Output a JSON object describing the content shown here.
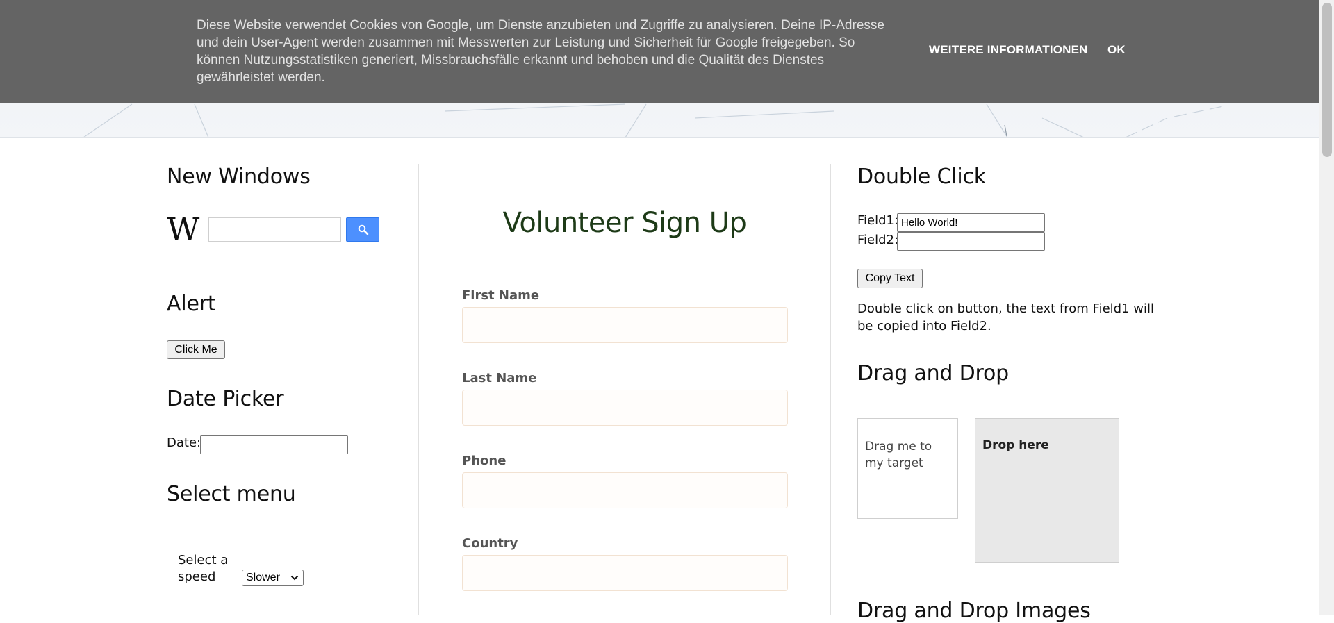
{
  "cookie_banner": {
    "text": "Diese Website verwendet Cookies von Google, um Dienste anzubieten und Zugriffe zu analysieren. Deine IP-Adresse und dein User-Agent werden zusammen mit Messwerten zur Leistung und Sicherheit für Google freigegeben. So können Nutzungsstatistiken generiert, Missbrauchsfälle erkannt und behoben und die Qualität des Dienstes gewährleistet werden.",
    "more_info_label": "WEITERE INFORMATIONEN",
    "ok_label": "OK"
  },
  "left": {
    "new_windows": {
      "heading": "New Windows",
      "logo_icon": "wikipedia-logo",
      "search_value": "",
      "search_icon": "magnifier-icon"
    },
    "alert": {
      "heading": "Alert",
      "button_label": "Click Me"
    },
    "date_picker": {
      "heading": "Date Picker",
      "label": "Date:",
      "value": ""
    },
    "select_menu": {
      "heading": "Select menu",
      "label_line1": "Select a",
      "label_line2": "speed",
      "selected": "Slower"
    }
  },
  "center": {
    "title": "Volunteer Sign Up",
    "fields": [
      {
        "label": "First Name",
        "value": ""
      },
      {
        "label": "Last Name",
        "value": ""
      },
      {
        "label": "Phone",
        "value": ""
      },
      {
        "label": "Country",
        "value": ""
      }
    ]
  },
  "right": {
    "double_click": {
      "heading": "Double Click",
      "field1_label": "Field1:",
      "field1_value": "Hello World!",
      "field2_label": "Field2:",
      "field2_value": "",
      "button_label": "Copy Text",
      "description": "Double click on button, the text from Field1 will be copied into Field2."
    },
    "drag_drop": {
      "heading": "Drag and Drop",
      "drag_text": "Drag me to my target",
      "drop_text": "Drop here"
    },
    "drag_drop_images": {
      "heading": "Drag and Drop Images"
    }
  },
  "colors": {
    "banner_bg": "#646464",
    "form_title": "#1d3a17",
    "search_button": "#4d90fe",
    "drop_box_bg": "#e8e8e8"
  }
}
